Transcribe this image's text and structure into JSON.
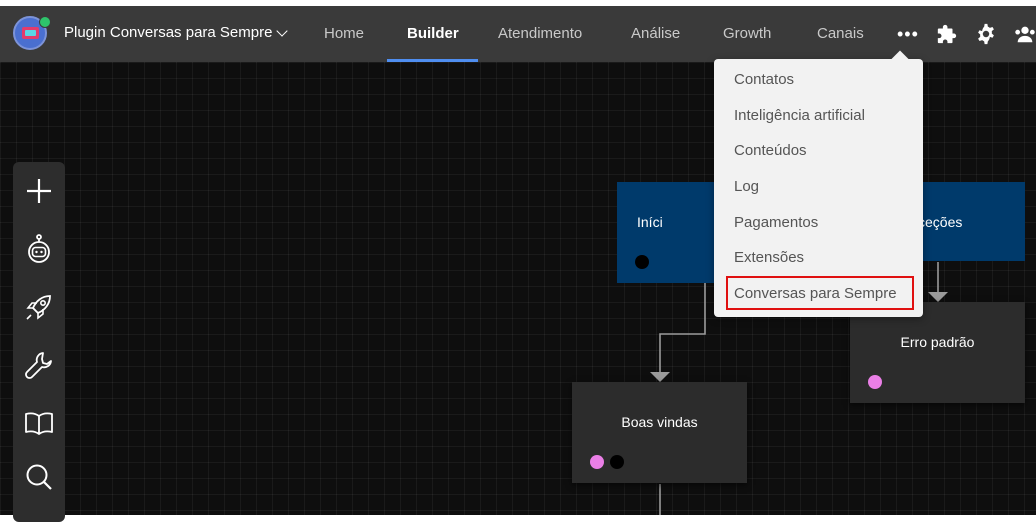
{
  "header": {
    "bot_name": "Plugin Conversas para Sempre",
    "nav": [
      {
        "label": "Home"
      },
      {
        "label": "Builder",
        "active": true
      },
      {
        "label": "Atendimento"
      },
      {
        "label": "Análise"
      },
      {
        "label": "Growth"
      },
      {
        "label": "Canais"
      }
    ],
    "more_label": "•••",
    "accent_color": "#4f8ef0"
  },
  "toolbar": {
    "icons": [
      "plus-icon",
      "robot-icon",
      "rocket-icon",
      "wrench-icon",
      "book-icon",
      "search-icon"
    ]
  },
  "flow": {
    "nodes": [
      {
        "title": "Iníci",
        "color": "#003a6b"
      },
      {
        "title": "ceções",
        "color": "#003a6b"
      },
      {
        "title": "Erro padrão",
        "color": "#2c2c2c"
      },
      {
        "title": "Boas vindas",
        "color": "#2c2c2c"
      }
    ],
    "port_colors": {
      "black": "#000000",
      "pink": "#ea7fe6"
    }
  },
  "dropdown": {
    "items": [
      {
        "label": "Contatos"
      },
      {
        "label": "Inteligência artificial"
      },
      {
        "label": "Conteúdos"
      },
      {
        "label": "Log"
      },
      {
        "label": "Pagamentos"
      },
      {
        "label": "Extensões"
      },
      {
        "label": "Conversas para Sempre",
        "highlighted": true
      }
    ],
    "highlight_color": "#e01010"
  }
}
